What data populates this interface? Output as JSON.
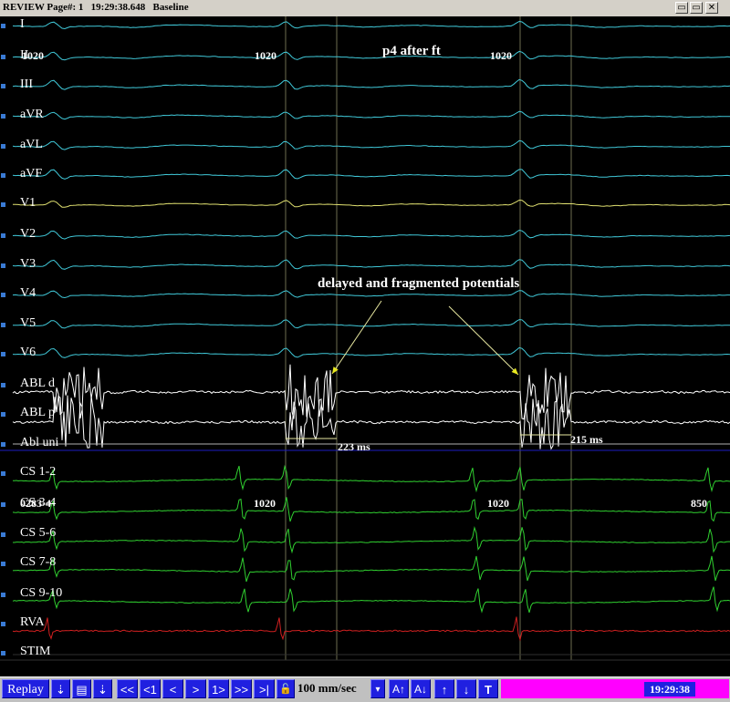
{
  "window": {
    "title": "REVIEW Page#: 1   19:29:38.648   Baseline",
    "buttons": [
      "▭",
      "▭",
      "✕"
    ]
  },
  "channels": {
    "surface": [
      "I",
      "II",
      "III",
      "aVR",
      "aVL",
      "aVF",
      "V1",
      "V2",
      "V3",
      "V4",
      "V5",
      "V6"
    ],
    "ablation": [
      "ABL d",
      "ABL p",
      "Abl uni"
    ],
    "cs": [
      "CS 1-2",
      "CS 3-4",
      "CS 5-6",
      "CS 7-8",
      "CS 9-10",
      "RVA",
      "STIM"
    ]
  },
  "intervals": {
    "top": [
      "1020",
      "1020",
      "1020"
    ],
    "cs": [
      "0283-4",
      "1020",
      "1020",
      "850"
    ]
  },
  "measurements": [
    "223 ms",
    "215 ms"
  ],
  "annotations": {
    "title": "p4 after ft",
    "note": "delayed and fragmented potentials"
  },
  "colors": {
    "surface": "#40c8d8",
    "v1": "#e0e070",
    "ablation": "#ffffff",
    "cs": "#30d030",
    "rva": "#d02020",
    "cursor": "#e8e8a0",
    "toolbar_button": "#2020e0",
    "status_bar": "#ff00ff"
  },
  "toolbar": {
    "replay": "Replay",
    "nav": [
      "⇣",
      "▤",
      "⇣",
      "<<",
      "<1",
      "<",
      ">",
      "1>",
      ">>",
      ">|",
      "🔓"
    ],
    "speed": "100 mm/sec",
    "tools": [
      "▾",
      "A↑",
      "A↓",
      "↑",
      "↓",
      "T"
    ],
    "time": "19:29:38"
  }
}
